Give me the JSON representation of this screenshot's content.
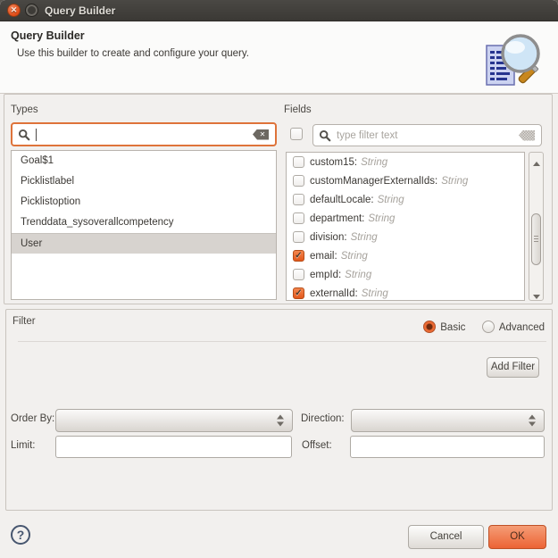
{
  "window": {
    "title": "Query Builder"
  },
  "titlebar": {
    "close_glyph": "✕"
  },
  "header": {
    "title": "Query Builder",
    "subtitle": "Use this builder to create and configure your query.",
    "icon": "document-magnifier-icon"
  },
  "types": {
    "label": "Types",
    "search_value": "",
    "items": [
      {
        "label": "Goal$1",
        "selected": false
      },
      {
        "label": "Picklistlabel",
        "selected": false
      },
      {
        "label": "Picklistoption",
        "selected": false
      },
      {
        "label": "Trenddata_sysoverallcompetency",
        "selected": false
      },
      {
        "label": "User",
        "selected": true
      }
    ]
  },
  "fields": {
    "label": "Fields",
    "select_all_checked": false,
    "filter_placeholder": "type filter text",
    "items": [
      {
        "name": "custom15:",
        "type": "String",
        "checked": false
      },
      {
        "name": "customManagerExternalIds:",
        "type": "String",
        "checked": false
      },
      {
        "name": "defaultLocale:",
        "type": "String",
        "checked": false
      },
      {
        "name": "department:",
        "type": "String",
        "checked": false
      },
      {
        "name": "division:",
        "type": "String",
        "checked": false
      },
      {
        "name": "email:",
        "type": "String",
        "checked": true
      },
      {
        "name": "empId:",
        "type": "String",
        "checked": false
      },
      {
        "name": "externalId:",
        "type": "String",
        "checked": true
      }
    ]
  },
  "filter": {
    "label": "Filter",
    "modes": [
      {
        "label": "Basic",
        "selected": true
      },
      {
        "label": "Advanced",
        "selected": false
      }
    ],
    "add_button_label": "Add Filter",
    "order_by_label": "Order By:",
    "direction_label": "Direction:",
    "limit_label": "Limit:",
    "offset_label": "Offset:",
    "order_by_value": "",
    "direction_value": "",
    "limit_value": "",
    "offset_value": ""
  },
  "footer": {
    "help_label": "?",
    "cancel_label": "Cancel",
    "ok_label": "OK"
  },
  "colors": {
    "accent_orange": "#e2571b",
    "focus_border": "#de733a",
    "titlebar": "#3b3935",
    "selection": "#d7d3cf",
    "ok_button": "#ec6335"
  }
}
